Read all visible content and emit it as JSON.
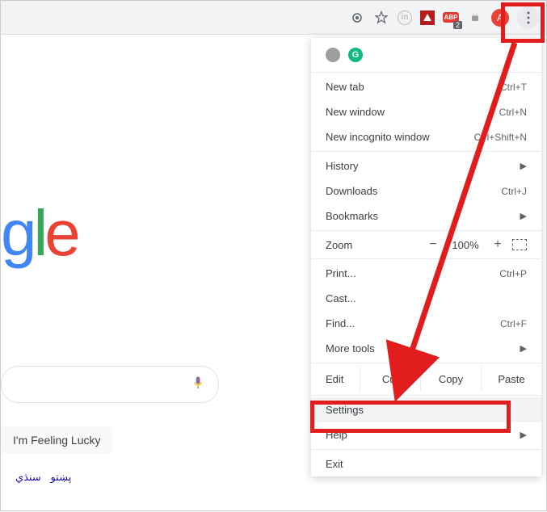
{
  "toolbar": {
    "badge_count": "2",
    "avatar_letter": "A"
  },
  "logo": {
    "g": "g",
    "l": "l",
    "e": "e"
  },
  "lucky_label": "I'm Feeling Lucky",
  "lang_link_1": "سنڌي",
  "lang_link_2": "پښتو",
  "menu": {
    "new_tab": {
      "label": "New tab",
      "shortcut": "Ctrl+T"
    },
    "new_window": {
      "label": "New window",
      "shortcut": "Ctrl+N"
    },
    "new_incognito": {
      "label": "New incognito window",
      "shortcut": "Ctrl+Shift+N"
    },
    "history": {
      "label": "History"
    },
    "downloads": {
      "label": "Downloads",
      "shortcut": "Ctrl+J"
    },
    "bookmarks": {
      "label": "Bookmarks"
    },
    "zoom": {
      "label": "Zoom",
      "value": "100%",
      "minus": "−",
      "plus": "+"
    },
    "print": {
      "label": "Print...",
      "shortcut": "Ctrl+P"
    },
    "cast": {
      "label": "Cast..."
    },
    "find": {
      "label": "Find...",
      "shortcut": "Ctrl+F"
    },
    "more_tools": {
      "label": "More tools"
    },
    "edit": {
      "label": "Edit",
      "cut": "Cut",
      "copy": "Copy",
      "paste": "Paste"
    },
    "settings": {
      "label": "Settings"
    },
    "help": {
      "label": "Help"
    },
    "exit": {
      "label": "Exit"
    }
  }
}
